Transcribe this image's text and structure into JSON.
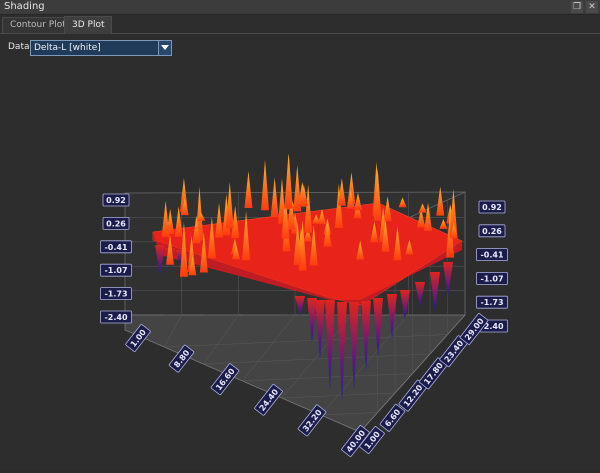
{
  "window": {
    "title": "Shading"
  },
  "tabs": [
    {
      "label": "Contour Plot",
      "active": false
    },
    {
      "label": "3D Plot",
      "active": true
    }
  ],
  "controls": {
    "data_label": "Data",
    "data_value": "Delta-L [white]"
  },
  "chart_data": {
    "type": "surface",
    "z_ticks": [
      "0.92",
      "0.26",
      "-0.41",
      "-1.07",
      "-1.73",
      "-2.40"
    ],
    "x_ticks": [
      "1.00",
      "8.80",
      "16.60",
      "24.40",
      "32.20",
      "40.00"
    ],
    "y_ticks": [
      "1.00",
      "6.60",
      "12.20",
      "17.80",
      "23.40",
      "29.00"
    ],
    "zlim": [
      -2.4,
      0.92
    ],
    "xlim": [
      1.0,
      40.0
    ],
    "ylim": [
      1.0,
      29.0
    ],
    "grid": true,
    "colormap": [
      "#2a2aa8",
      "#8a1a6a",
      "#ff2a10",
      "#ffa020"
    ]
  }
}
